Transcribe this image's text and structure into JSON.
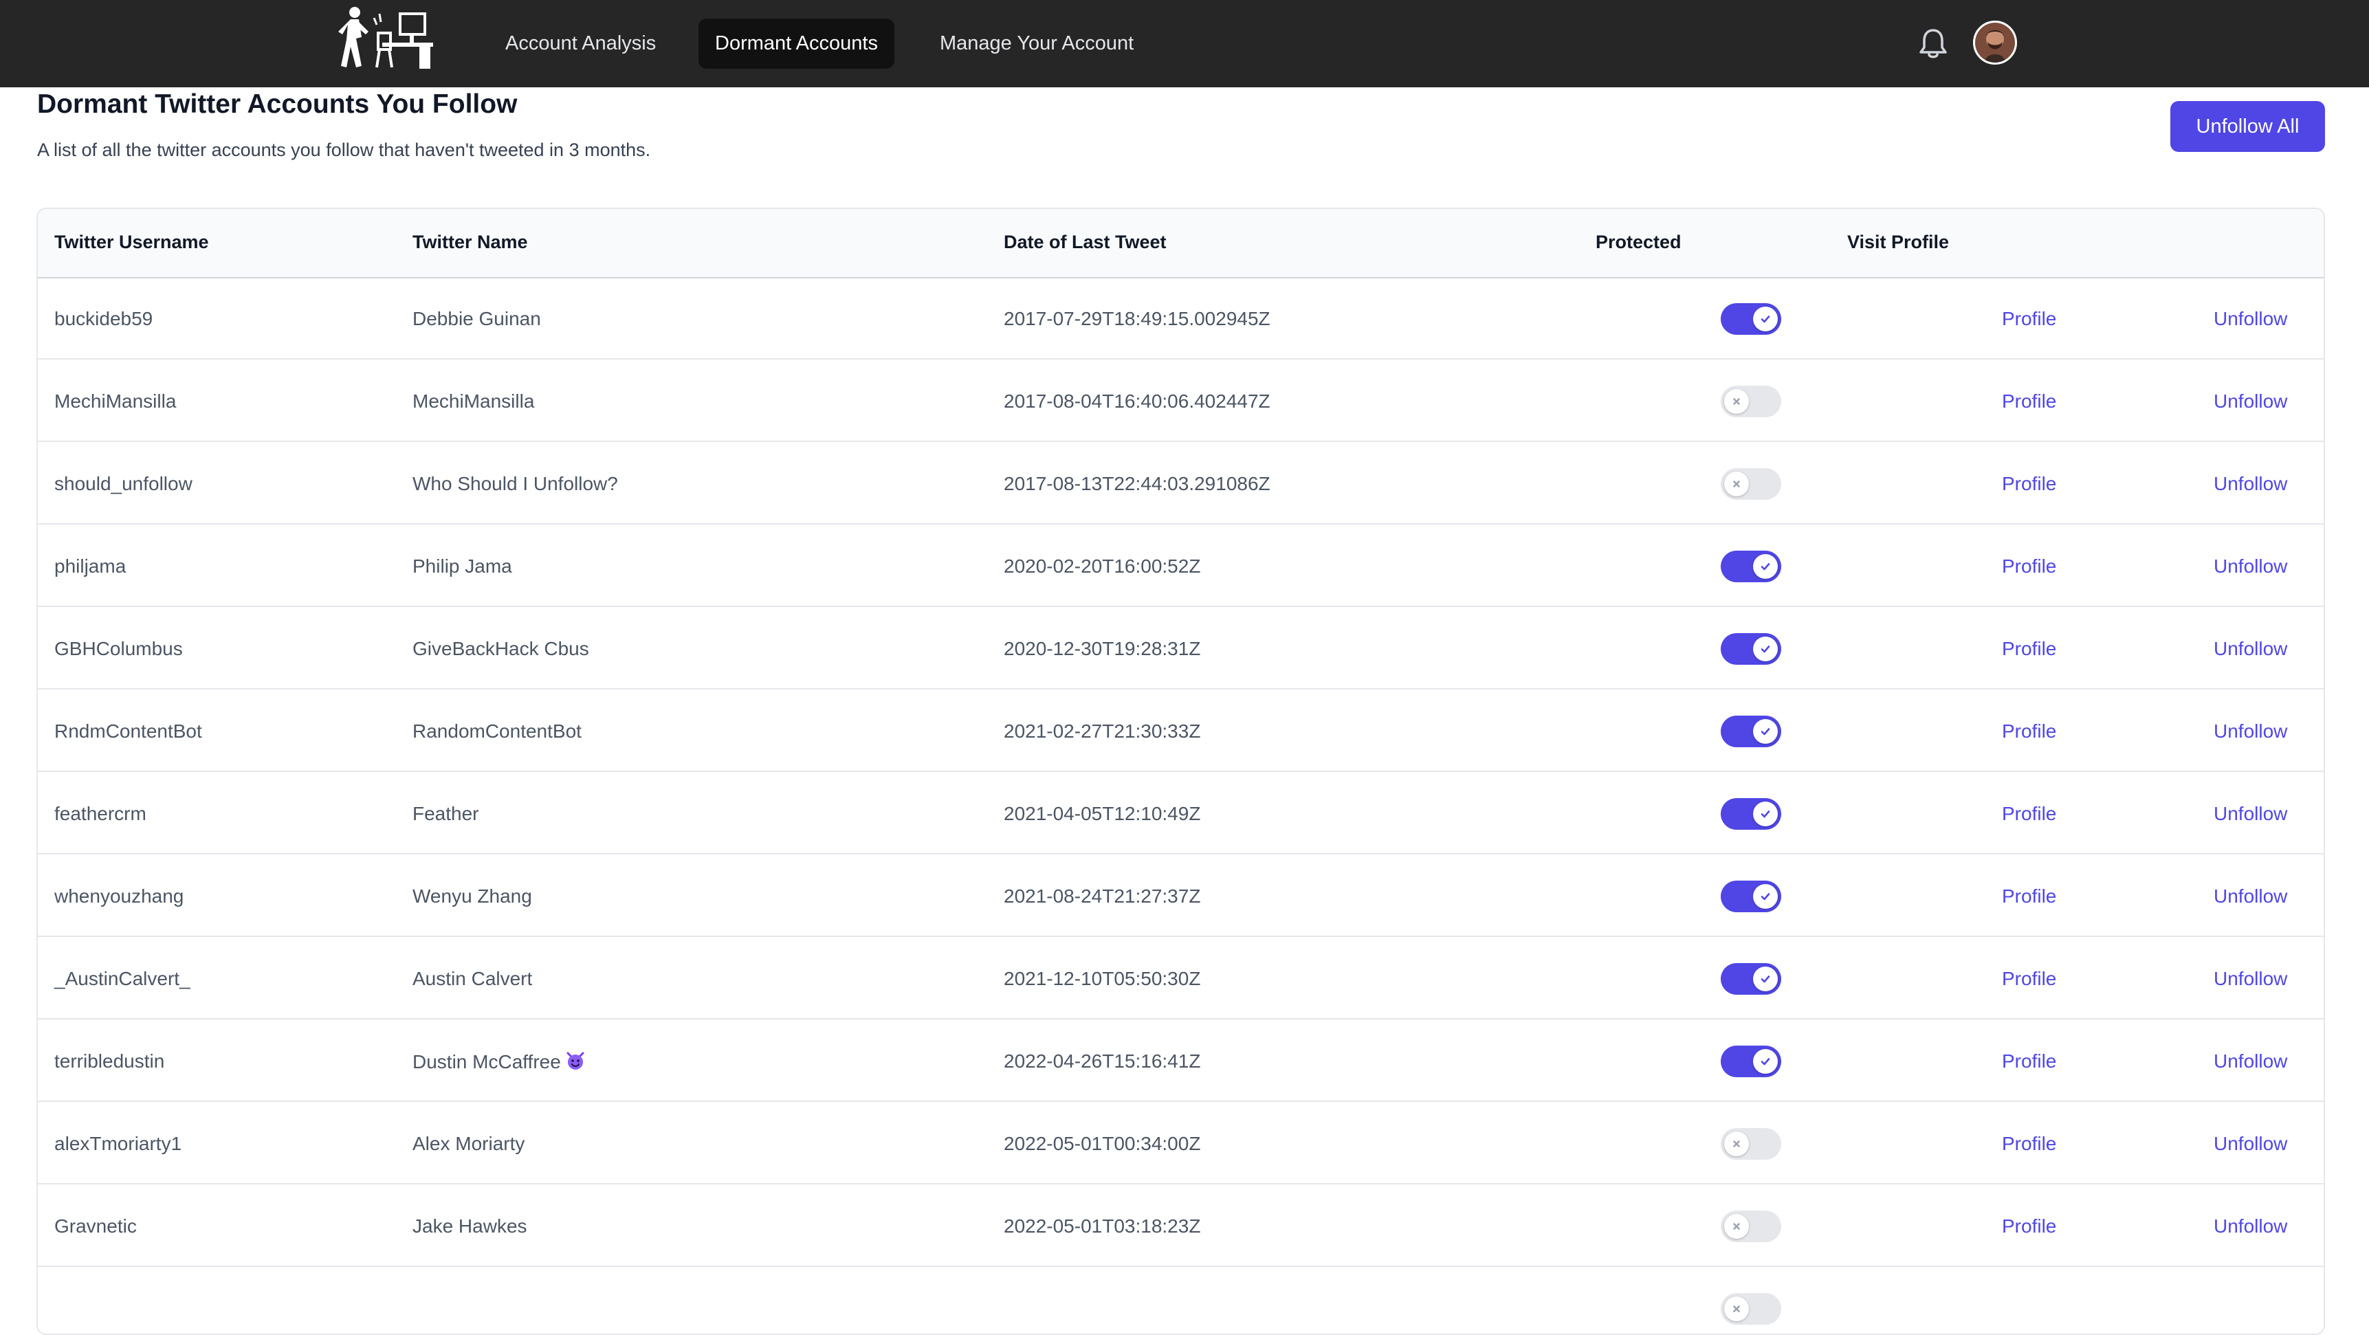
{
  "nav": {
    "links": [
      {
        "label": "Account Analysis"
      },
      {
        "label": "Dormant Accounts"
      },
      {
        "label": "Manage Your Account"
      }
    ],
    "active_index": 1,
    "bar_color": "#262626"
  },
  "header": {
    "title": "Dormant Twitter Accounts You Follow",
    "subtitle": "A list of all the twitter accounts you follow that haven't tweeted in 3 months.",
    "unfollow_all_label": "Unfollow All"
  },
  "table": {
    "columns": [
      "Twitter Username",
      "Twitter Name",
      "Date of Last Tweet",
      "Protected",
      "Visit Profile"
    ],
    "profile_label": "Profile",
    "unfollow_label": "Unfollow",
    "rows": [
      {
        "username": "buckideb59",
        "name": "Debbie Guinan",
        "date": "2017-07-29T18:49:15.002945Z",
        "protected": true
      },
      {
        "username": "MechiMansilla",
        "name": "MechiMansilla",
        "date": "2017-08-04T16:40:06.402447Z",
        "protected": false
      },
      {
        "username": "should_unfollow",
        "name": "Who Should I Unfollow?",
        "date": "2017-08-13T22:44:03.291086Z",
        "protected": false
      },
      {
        "username": "philjama",
        "name": "Philip Jama",
        "date": "2020-02-20T16:00:52Z",
        "protected": true
      },
      {
        "username": "GBHColumbus",
        "name": "GiveBackHack Cbus",
        "date": "2020-12-30T19:28:31Z",
        "protected": true
      },
      {
        "username": "RndmContentBot",
        "name": "RandomContentBot",
        "date": "2021-02-27T21:30:33Z",
        "protected": true
      },
      {
        "username": "feathercrm",
        "name": "Feather",
        "date": "2021-04-05T12:10:49Z",
        "protected": true
      },
      {
        "username": "whenyouzhang",
        "name": "Wenyu Zhang",
        "date": "2021-08-24T21:27:37Z",
        "protected": true
      },
      {
        "username": "_AustinCalvert_",
        "name": "Austin Calvert",
        "date": "2021-12-10T05:50:30Z",
        "protected": true
      },
      {
        "username": "terribledustin",
        "name": "Dustin McCaffree",
        "name_icon": "smiling-devil-emoji",
        "date": "2022-04-26T15:16:41Z",
        "protected": true
      },
      {
        "username": "alexTmoriarty1",
        "name": "Alex Moriarty",
        "date": "2022-05-01T00:34:00Z",
        "protected": false
      },
      {
        "username": "Gravnetic",
        "name": "Jake Hawkes",
        "date": "2022-05-01T03:18:23Z",
        "protected": false
      },
      {
        "username": "",
        "name": "",
        "date": "",
        "protected": false
      }
    ]
  },
  "colors": {
    "accent": "#4f46e5",
    "toggle_off": "#e5e7eb",
    "header_bg": "#f9fafb"
  },
  "icons": {
    "logo": "person-leaving-desk-logo",
    "notifications": "bell-icon",
    "avatar": "user-avatar",
    "toggle_on": "check-icon",
    "toggle_off": "x-icon"
  }
}
